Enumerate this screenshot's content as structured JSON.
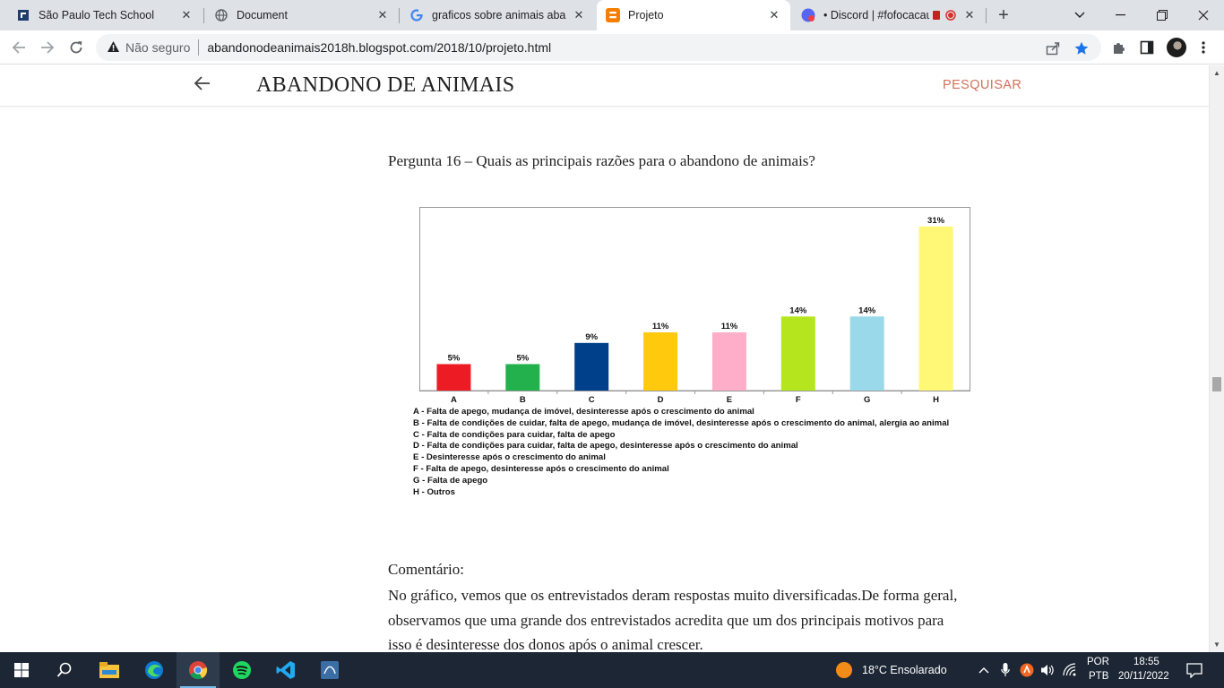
{
  "browser": {
    "tabs": [
      {
        "title": "São Paulo Tech School",
        "icon": "sptech-icon",
        "active": false
      },
      {
        "title": "Document",
        "icon": "globe-icon",
        "active": false
      },
      {
        "title": "graficos sobre animais abandonados",
        "icon": "google-icon",
        "active": false
      },
      {
        "title": "Projeto",
        "icon": "blogger-icon",
        "active": true
      },
      {
        "title": "• Discord | #fofocacau",
        "icon": "discord-icon",
        "active": false
      }
    ],
    "security_label": "Não seguro",
    "url": "abandonodeanimais2018h.blogspot.com/2018/10/projeto.html"
  },
  "blog": {
    "title": "ABANDONO DE ANIMAIS",
    "search_label": "PESQUISAR"
  },
  "post": {
    "question": "Pergunta 16 – Quais as principais razões para o abandono de animais?",
    "legend": [
      "A - Falta de apego, mudança de imóvel, desinteresse após o crescimento do animal",
      "B - Falta de condições de cuidar, falta de apego, mudança de imóvel, desinteresse após o crescimento do animal, alergia ao animal",
      "C - Falta de condições para cuidar, falta de apego",
      "D - Falta de condições para cuidar, falta de apego, desinteresse após o crescimento do animal",
      "E - Desinteresse após o crescimento do animal",
      "F - Falta de apego, desinteresse após o crescimento do animal",
      "G - Falta de apego",
      "H - Outros"
    ],
    "comment_title": "Comentário:",
    "comment_text": "No gráfico, vemos que os entrevistados deram respostas muito diversificadas.De forma geral, observamos que uma grande dos entrevistados acredita que um dos principais motivos para isso é desinteresse dos donos após o animal crescer."
  },
  "chart_data": {
    "type": "bar",
    "categories": [
      "A",
      "B",
      "C",
      "D",
      "E",
      "F",
      "G",
      "H"
    ],
    "values": [
      5,
      5,
      9,
      11,
      11,
      14,
      14,
      31
    ],
    "value_labels": [
      "5%",
      "5%",
      "9%",
      "11%",
      "11%",
      "14%",
      "14%",
      "31%"
    ],
    "colors": [
      "#ed1c24",
      "#22b14c",
      "#00408a",
      "#ffc90e",
      "#ffaec9",
      "#b5e61d",
      "#99d9ea",
      "#fff776"
    ],
    "ylim": [
      0,
      33
    ],
    "grid": false,
    "legend_position": "below"
  },
  "taskbar": {
    "weather": "18°C  Ensolarado",
    "lang_1": "POR",
    "lang_2": "PTB",
    "time": "18:55",
    "date": "20/11/2022"
  }
}
